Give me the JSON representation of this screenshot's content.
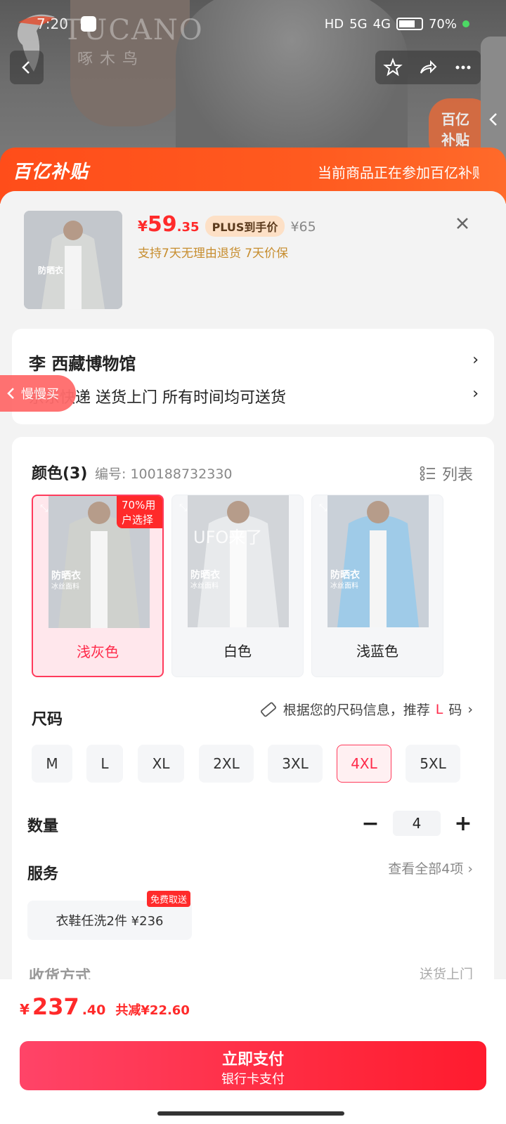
{
  "status_bar": {
    "time": "7:20",
    "battery": "70%",
    "network_a": "5G",
    "network_b": "4G",
    "hd": "HD"
  },
  "hero": {
    "brand_en": "TUCANO",
    "brand_cn": "啄木鸟",
    "badge": "百亿\n补贴"
  },
  "banner": {
    "logo": "百亿补贴",
    "note": "当前商品正在参加百亿补贴"
  },
  "product": {
    "price_currency": "¥",
    "price_int": "59",
    "price_dec": ".35",
    "plus_tag": "PLUS到手价",
    "original_price": "¥65",
    "promise": "支持7天无理由退货  7天价保",
    "thumb_text": "防晒衣"
  },
  "address": {
    "name": "李  西藏博物馆",
    "delivery": "京东快递 送货上门 所有时间均可送货"
  },
  "float_pill": {
    "label": "慢慢买"
  },
  "color_section": {
    "title": "颜色(3)",
    "sku": "编号: 100188732330",
    "list_label": "列表",
    "popular_tag": "70%用户选择",
    "overlay": "UFO来了",
    "swatch_text": "防晒衣",
    "swatch_sub": "冰丝面料",
    "options": [
      {
        "label": "浅灰色",
        "color": "#c9cbc8"
      },
      {
        "label": "白色",
        "color": "#e3e6ea"
      },
      {
        "label": "浅蓝色",
        "color": "#9fcbe8"
      }
    ],
    "selected_index": 0
  },
  "size_section": {
    "title": "尺码",
    "hint_prefix": "根据您的尺码信息，推荐",
    "hint_size": "L",
    "hint_suffix": "码",
    "options": [
      "M",
      "L",
      "XL",
      "2XL",
      "3XL",
      "4XL",
      "5XL"
    ],
    "selected_index": 5
  },
  "quantity": {
    "title": "数量",
    "value": "4",
    "minus": "−",
    "plus": "+"
  },
  "service": {
    "title": "服务",
    "view_all": "查看全部4项",
    "chip": "衣鞋任洗2件  ¥236",
    "chip_tag": "免费取送"
  },
  "partial_row": {
    "left": "收货方式",
    "right": "送货上门"
  },
  "bottom": {
    "currency": "¥",
    "total_int": "237",
    "total_dec": ".40",
    "saving": "共减¥22.60",
    "pay_label": "立即支付",
    "pay_method": "银行卡支付"
  },
  "colors": {
    "accent": "#ff2a2a",
    "banner": "#ff5a1f",
    "selected_border": "#ff3b5c"
  }
}
